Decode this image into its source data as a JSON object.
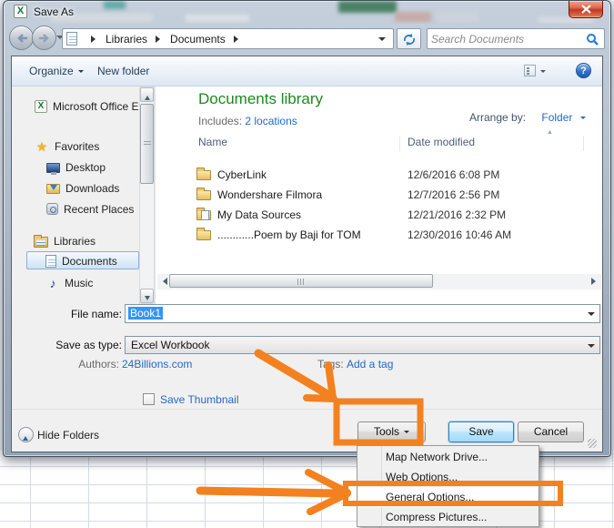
{
  "colors": {
    "annotation": "#F4811F",
    "link": "#2569C8",
    "library_title_green": "#1D8A1D"
  },
  "icons": {
    "star": "★",
    "music": "♪",
    "help": "?",
    "sort": "▲"
  },
  "window": {
    "title": "Save As"
  },
  "nav": {
    "breadcrumb": [
      "Libraries",
      "Documents"
    ],
    "search_placeholder": "Search Documents"
  },
  "toolbar": {
    "organize": "Organize",
    "new_folder": "New folder"
  },
  "sidebar": {
    "items": [
      {
        "label": "Microsoft Office Ex"
      },
      {
        "label": "Favorites"
      },
      {
        "label": "Desktop"
      },
      {
        "label": "Downloads"
      },
      {
        "label": "Recent Places"
      },
      {
        "label": "Libraries"
      },
      {
        "label": "Documents"
      },
      {
        "label": "Music"
      }
    ]
  },
  "library": {
    "title": "Documents library",
    "includes_label": "Includes:",
    "includes_link": "2 locations",
    "arrange_label": "Arrange by:",
    "arrange_value": "Folder"
  },
  "list": {
    "columns": [
      "Name",
      "Date modified"
    ],
    "rows": [
      {
        "name": "CyberLink",
        "date": "12/6/2016 6:08 PM"
      },
      {
        "name": "Wondershare Filmora",
        "date": "12/7/2016 2:56 PM"
      },
      {
        "name": "My Data Sources",
        "date": "12/21/2016 2:32 PM"
      },
      {
        "name": "............Poem by Baji for TOM",
        "date": "12/30/2016 10:46 AM"
      }
    ]
  },
  "form": {
    "file_name_label": "File name:",
    "file_name_value": "Book1",
    "save_type_label": "Save as type:",
    "save_type_value": "Excel Workbook",
    "authors_label": "Authors:",
    "authors_value": "24Billions.com",
    "tags_label": "Tags:",
    "tags_value": "Add a tag",
    "save_thumbnail_label": "Save Thumbnail"
  },
  "footer": {
    "hide_folders": "Hide Folders",
    "tools": "Tools",
    "save": "Save",
    "cancel": "Cancel"
  },
  "menu": {
    "items": [
      "Map Network Drive...",
      "Web Options...",
      "General Options...",
      "Compress Pictures..."
    ]
  }
}
